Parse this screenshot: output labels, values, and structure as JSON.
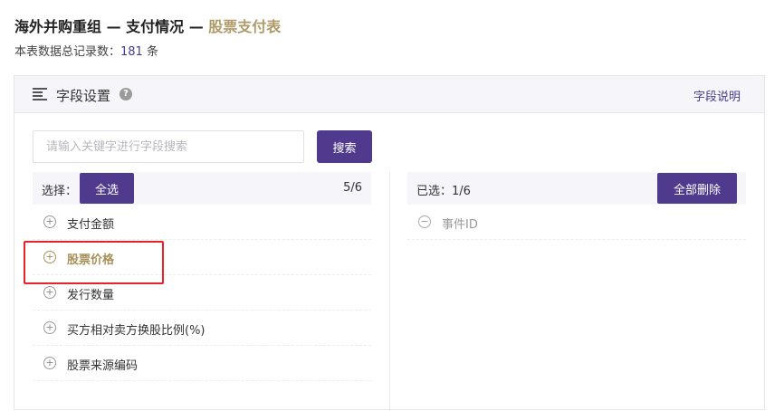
{
  "title": {
    "part1": "海外并购重组 — 支付情况 — ",
    "part2": "股票支付表"
  },
  "record": {
    "prefix": "本表数据总记录数：",
    "count": "181",
    "suffix": " 条"
  },
  "panel": {
    "title": "字段设置",
    "help_icon": "?",
    "link": "字段说明"
  },
  "search": {
    "placeholder": "请输入关键字进行字段搜索",
    "value": "",
    "button": "搜索"
  },
  "left": {
    "label": "选择：",
    "select_all": "全选",
    "count": "5/6",
    "items": [
      {
        "label": "支付金额",
        "icon": "+"
      },
      {
        "label": "股票价格",
        "icon": "+"
      },
      {
        "label": "发行数量",
        "icon": "+"
      },
      {
        "label": "买方相对卖方换股比例(%)",
        "icon": "+"
      },
      {
        "label": "股票来源编码",
        "icon": "+"
      }
    ]
  },
  "right": {
    "label": "已选：1/6",
    "delete_all": "全部删除",
    "items": [
      {
        "label": "事件ID",
        "icon": "−"
      }
    ]
  },
  "colors": {
    "accent_purple": "#4f3a8e",
    "accent_gold": "#b09a6a",
    "annotation_red": "#e8222a"
  }
}
